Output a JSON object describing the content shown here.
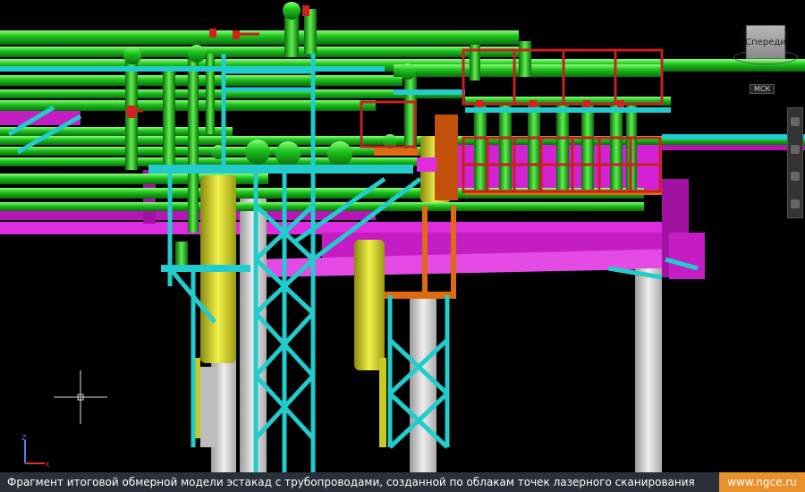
{
  "viewcube": {
    "label": "Спереди"
  },
  "ucs_menu": {
    "label": "МСК"
  },
  "axes": {
    "z": "Z",
    "x": "X"
  },
  "caption": {
    "text": "Фрагмент итоговой обмерной модели эстакад с трубопроводами, созданной по облакам точек лазерного сканирования"
  },
  "site": {
    "text": "www.ngce.ru"
  },
  "colors": {
    "pipe": "#1fc41f",
    "pipe_hi": "#7dff6a",
    "steel": "#22cccc",
    "platform": "#d322d3",
    "railing": "#c82020",
    "vessel": "#d8d820",
    "column": "#cccccc",
    "orange": "#e06a10",
    "caption_bg": "#2a2f3a",
    "brand": "#e8912b"
  }
}
